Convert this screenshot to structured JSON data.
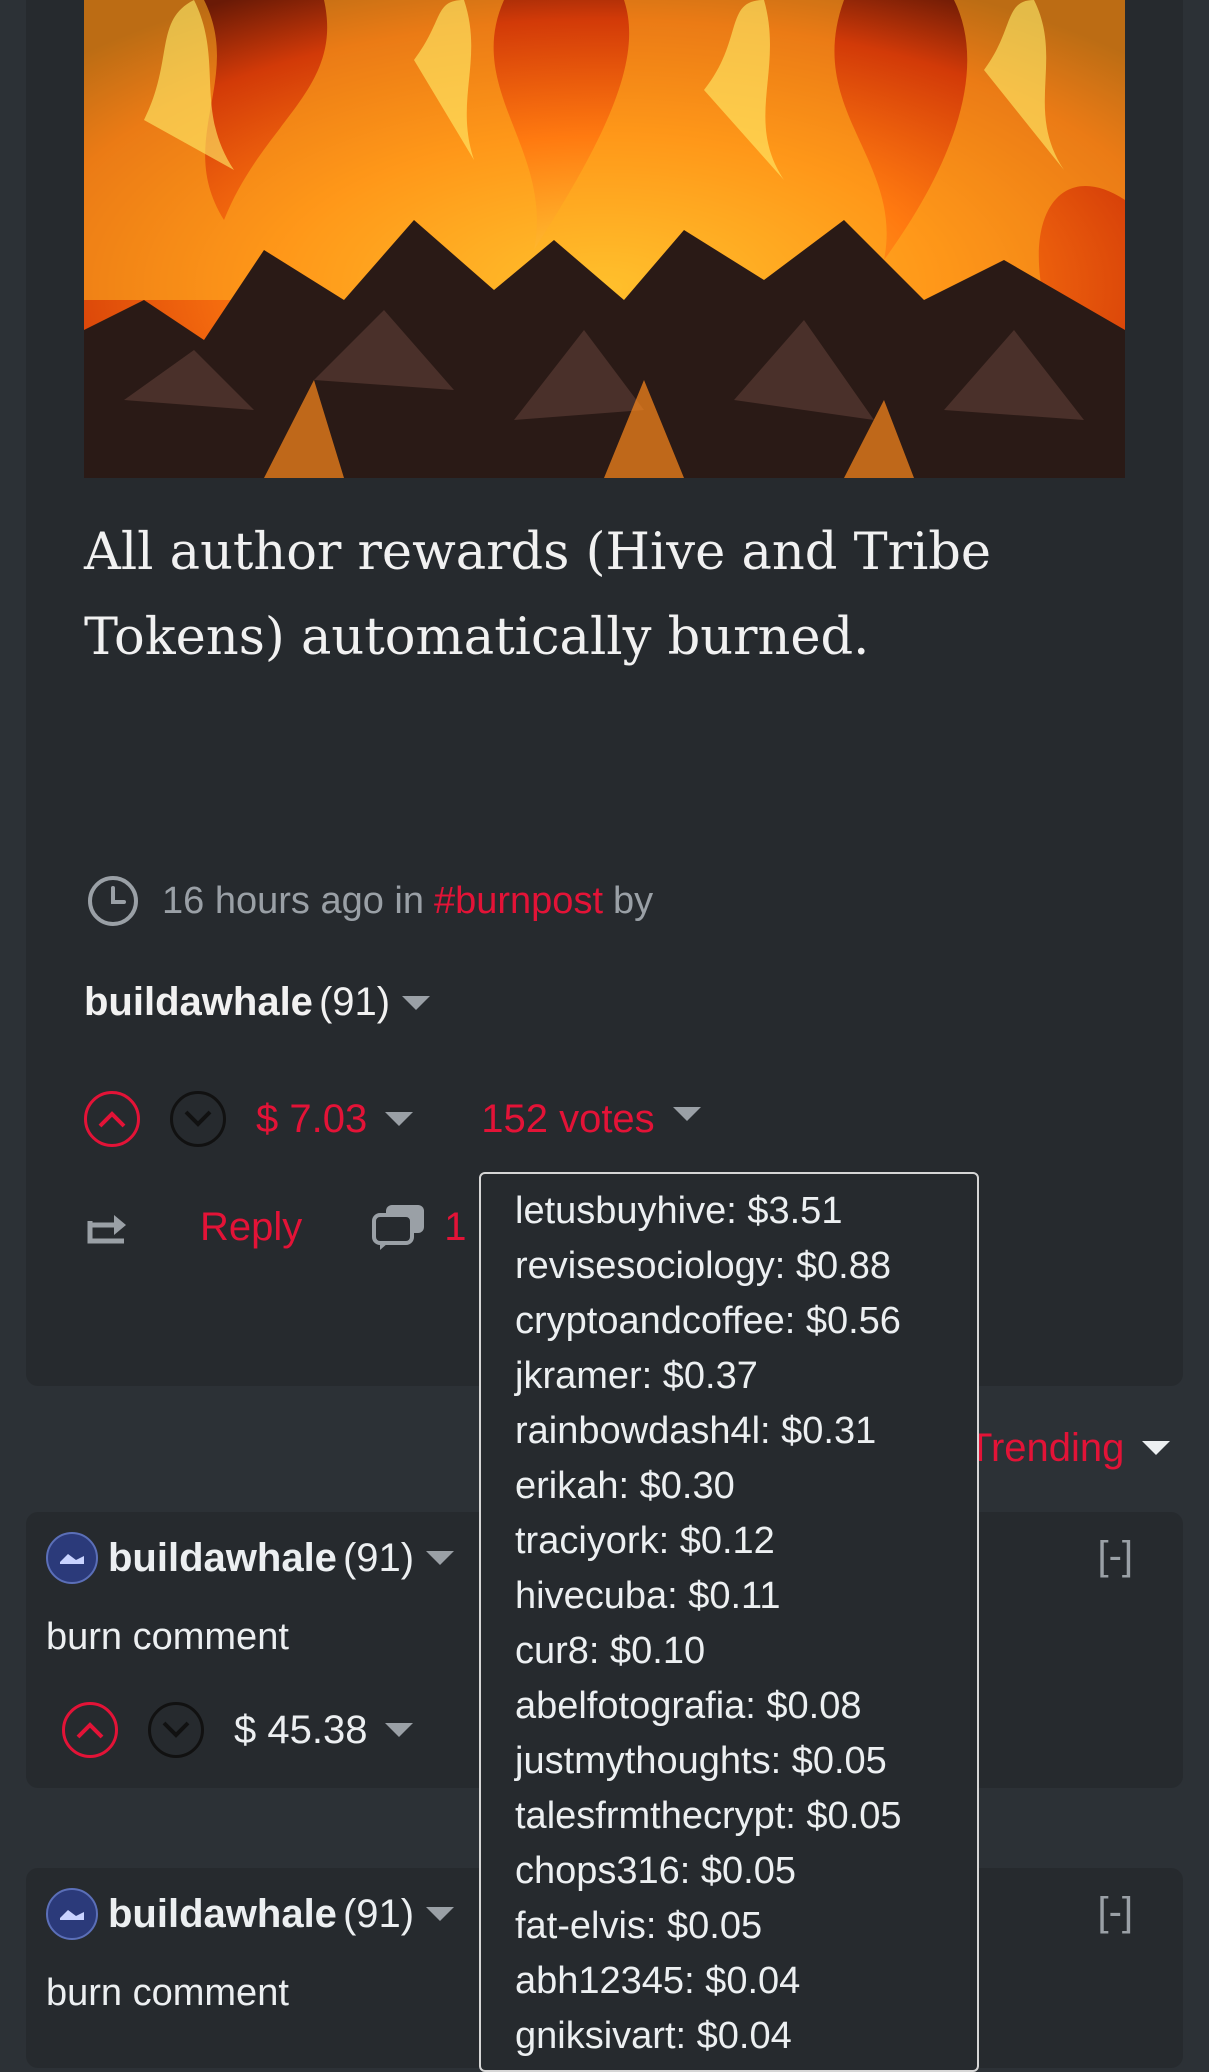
{
  "post": {
    "body": "All author rewards (Hive and Tribe Tokens) automatically burned.",
    "time": "16 hours ago in",
    "tag": "#burnpost",
    "by": "by",
    "author_name": "buildawhale",
    "author_rep": "(91)",
    "payout": "$ 7.03",
    "votes_label": "152 votes",
    "reply_label": "Reply",
    "comment_count": "1"
  },
  "sort_label": "Trending",
  "votes_popup": [
    "letusbuyhive: $3.51",
    "revisesociology: $0.88",
    "cryptoandcoffee: $0.56",
    "jkramer: $0.37",
    "rainbowdash4l: $0.31",
    "erikah: $0.30",
    "traciyork: $0.12",
    "hivecuba: $0.11",
    "cur8: $0.10",
    "abelfotografia: $0.08",
    "justmythoughts: $0.05",
    "talesfrmthecrypt: $0.05",
    "chops316: $0.05",
    "fat-elvis: $0.05",
    "abh12345: $0.04",
    "gniksivart: $0.04"
  ],
  "comments": [
    {
      "author": "buildawhale",
      "rep": "(91)",
      "body": "burn comment",
      "payout": "$ 45.38",
      "collapse": "[-]"
    },
    {
      "author": "buildawhale",
      "rep": "(91)",
      "body": "burn comment",
      "collapse": "[-]"
    }
  ],
  "colors": {
    "accent": "#e31337",
    "card": "#262a2e",
    "background": "#2c3136",
    "muted": "#9aa0a6"
  },
  "icons": [
    "clock-icon",
    "upvote-icon",
    "downvote-icon",
    "reblog-icon",
    "comments-icon",
    "avatar-icon"
  ]
}
